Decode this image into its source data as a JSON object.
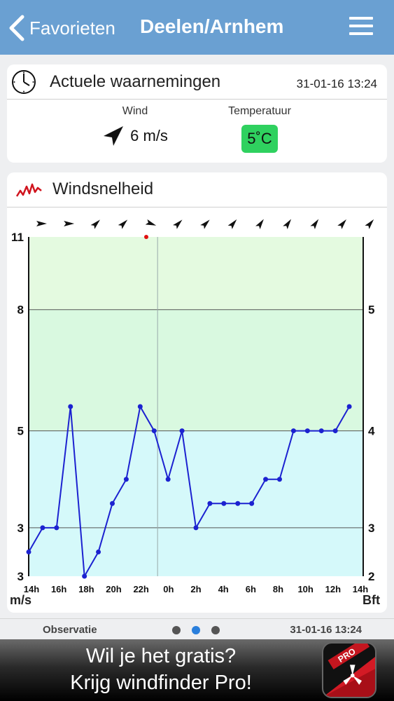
{
  "nav": {
    "back_label": "Favorieten",
    "title": "Deelen/Arnhem",
    "menu_icon": "hamburger-menu-icon"
  },
  "observations": {
    "title": "Actuele waarnemingen",
    "timestamp": "31-01-16 13:24",
    "wind_label": "Wind",
    "wind_value": "6 m/s",
    "temp_label": "Temperatuur",
    "temp_value": "5˚C",
    "temp_color": "#2fd15f",
    "icons": [
      "clock-icon",
      "wind-direction-arrow-icon"
    ]
  },
  "chart_section": {
    "title": "Windsnelheid",
    "icon": "wind-graph-icon"
  },
  "chart_data": {
    "type": "line",
    "x": [
      "14h",
      "",
      "16h",
      "",
      "18h",
      "",
      "20h",
      "",
      "22h",
      "",
      "0h",
      "",
      "2h",
      "",
      "4h",
      "",
      "6h",
      "",
      "8h",
      "",
      "10h",
      "",
      "12h",
      "",
      "14h"
    ],
    "values": [
      2.5,
      3,
      3,
      5.5,
      2,
      2.5,
      3.5,
      4,
      5.5,
      5,
      4,
      5,
      3,
      3.5,
      3.5,
      3.5,
      3.5,
      4,
      4,
      5,
      5,
      5,
      5,
      5.5
    ],
    "series_color": "#1c22d0",
    "tick_labels_left": [
      "3",
      "3",
      "5",
      "8",
      "11"
    ],
    "tick_labels_right": [
      "2",
      "3",
      "4",
      "5"
    ],
    "left_unit": "m/s",
    "right_unit": "Bft",
    "ylim": [
      2,
      9
    ],
    "bands": [
      {
        "from": 2,
        "to": 5,
        "color": "#d5f9fa"
      },
      {
        "from": 5,
        "to": 7.5,
        "color": "#d9f9e0"
      },
      {
        "from": 7.5,
        "to": 9,
        "color": "#e4fae0"
      }
    ],
    "x_tick_labels": [
      "14h",
      "16h",
      "18h",
      "20h",
      "22h",
      "0h",
      "2h",
      "4h",
      "6h",
      "8h",
      "10h",
      "12h",
      "14h"
    ],
    "direction_arrows_deg": [
      90,
      90,
      45,
      45,
      110,
      45,
      45,
      40,
      35,
      35,
      35,
      40,
      40
    ],
    "marker_color": "#e01010"
  },
  "footer": {
    "tab_label": "Observatie",
    "timestamp": "31-01-16 13:24",
    "page_count": 3,
    "active_page": 1
  },
  "ad": {
    "line1": "Wil je het gratis?",
    "line2": "Krijg windfinder Pro!",
    "badge": "PRO"
  }
}
